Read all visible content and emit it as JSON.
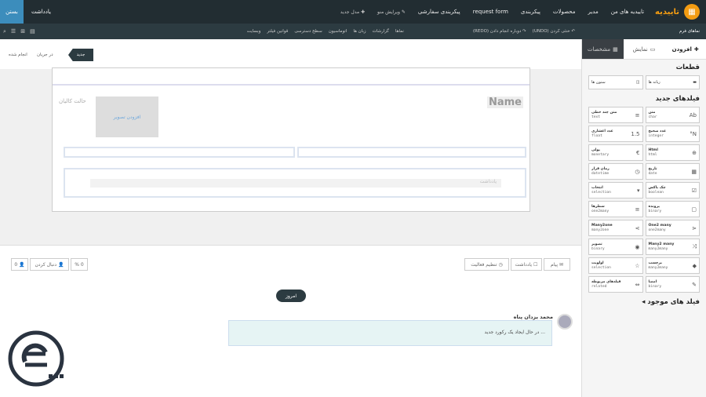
{
  "topbar": {
    "brand": "تاییدیه",
    "menu": [
      "تاییدیه های من",
      "مدیر",
      "محصولات",
      "پیکربندی",
      "request form",
      "پیکربندی سفارشی"
    ],
    "edit_menu": "ویرایش منو",
    "new_model": "مدل جدید",
    "note": "یادداشت",
    "close": "بستن"
  },
  "toolbar2": {
    "undo": "خنثی کردن (UNDO)",
    "redo": "دوباره انجام دادن (REDO)",
    "items": [
      "نماها",
      "گزارشات",
      "زبان ها",
      "اتوماسیون",
      "سطح دسترسی",
      "قوانین فیلتر",
      "وبسایت"
    ],
    "form_label": "نماهای فرم"
  },
  "panel": {
    "tabs": [
      "افزودن",
      "نمایش",
      "مشخصات"
    ],
    "blocks_title": "قطعات",
    "blocks": [
      "زبانه ها",
      "ستون ها"
    ],
    "new_fields_title": "فیلدهای جدید",
    "fields": [
      [
        "متن",
        "char"
      ],
      [
        "متن چند خطی",
        "text"
      ],
      [
        "عدد صحیح",
        "integer"
      ],
      [
        "عدد اعشاری",
        "float"
      ],
      [
        "Html",
        "html"
      ],
      [
        "پولی",
        "monetary"
      ],
      [
        "تاریخ",
        "date"
      ],
      [
        "زمان قرار",
        "datetime"
      ],
      [
        "چک باکس",
        "boolean"
      ],
      [
        "انتخاب",
        "selection"
      ],
      [
        "پرونده",
        "binary"
      ],
      [
        "سطرها",
        "one2many"
      ],
      [
        "One2 many",
        "one2many"
      ],
      [
        "Many2one",
        "many2one"
      ],
      [
        "Many2 many",
        "many2many"
      ],
      [
        "تصویر",
        "binary"
      ],
      [
        "برچسب",
        "many2many"
      ],
      [
        "اولویت",
        "selection"
      ],
      [
        "امضا",
        "binary"
      ],
      [
        "فیلدهای مربوطه",
        "related"
      ]
    ],
    "existing_title": "فیلد های موجود"
  },
  "status": {
    "new": "جدید",
    "progress": "در جریان",
    "done": "انجام شده"
  },
  "form": {
    "name": "Name",
    "image": "افزودن تصویر",
    "tags": "حالت کالیان",
    "notes": "یادداشت"
  },
  "chatter": {
    "message": "پیام",
    "note": "یادداشت",
    "activity": "تنظیم فعالیت",
    "percent": "0 %",
    "follow": "دنبال کردن",
    "followers": "0",
    "today": "امروز",
    "author": "محمد یزدان پناه",
    "msg": "در حال ایجاد یک رکورد جدید ..."
  }
}
